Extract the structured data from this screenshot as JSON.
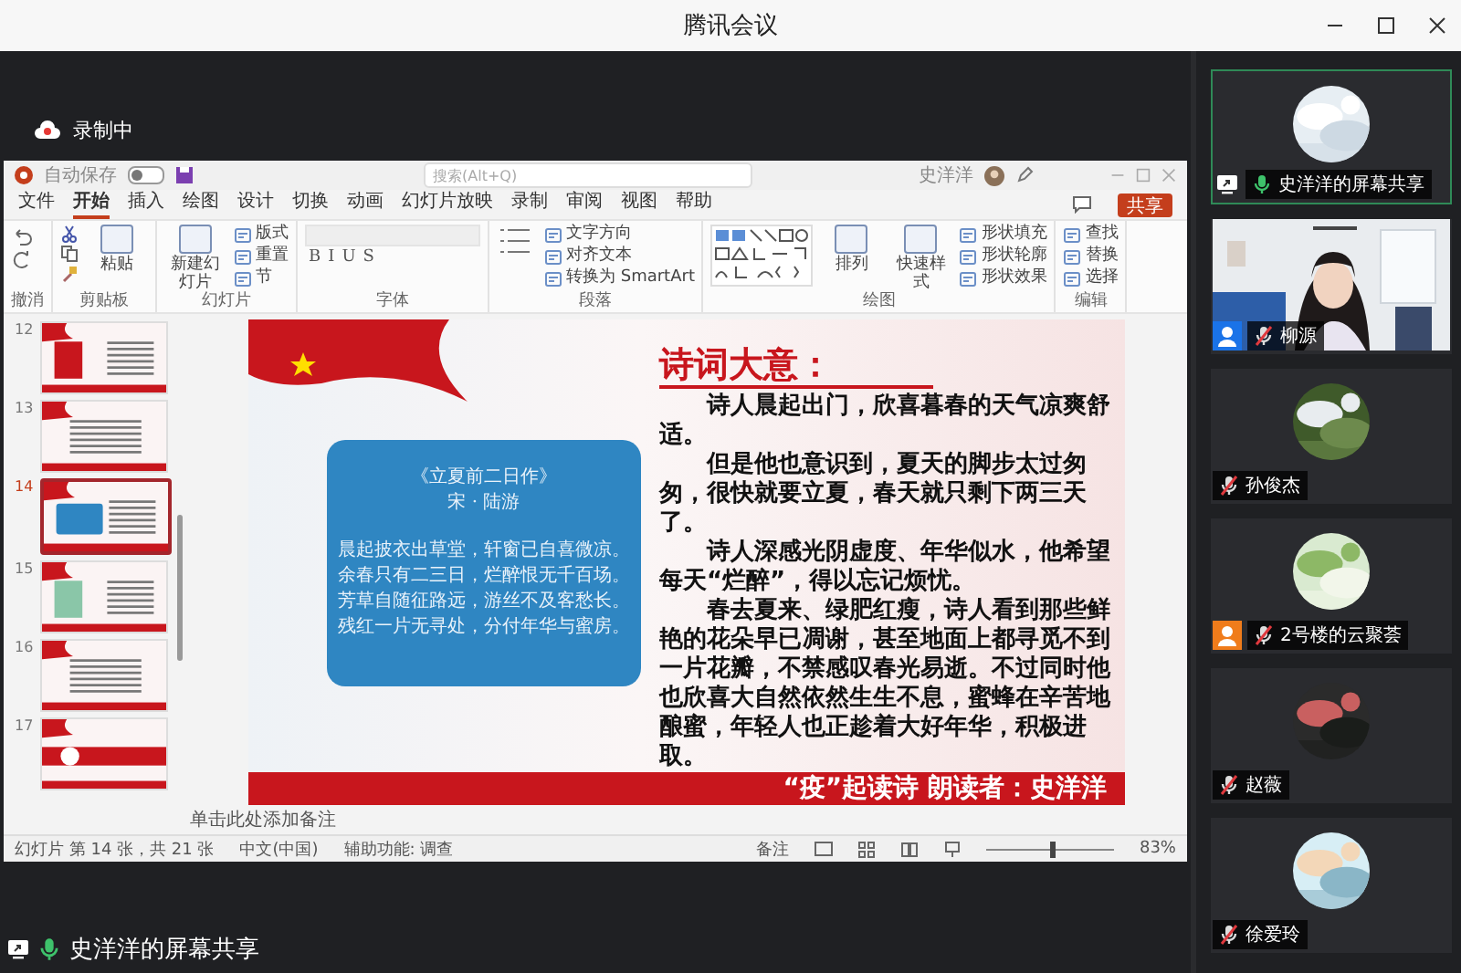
{
  "app": {
    "title": "腾讯会议"
  },
  "recording": {
    "label": "录制中"
  },
  "ppt": {
    "autosave_label": "自动保存",
    "autosave_on": false,
    "search": {
      "placeholder": "搜索(Alt+Q)"
    },
    "user": "史洋洋",
    "share_button": "共享",
    "tabs": [
      {
        "label": "文件",
        "selected": false
      },
      {
        "label": "开始",
        "selected": true
      },
      {
        "label": "插入",
        "selected": false
      },
      {
        "label": "绘图",
        "selected": false
      },
      {
        "label": "设计",
        "selected": false
      },
      {
        "label": "切换",
        "selected": false
      },
      {
        "label": "动画",
        "selected": false
      },
      {
        "label": "幻灯片放映",
        "selected": false
      },
      {
        "label": "录制",
        "selected": false
      },
      {
        "label": "审阅",
        "selected": false
      },
      {
        "label": "视图",
        "selected": false
      },
      {
        "label": "帮助",
        "selected": false
      }
    ],
    "ribbon": [
      {
        "label": "撤消",
        "kind": "undo"
      },
      {
        "label": "剪贴板",
        "kind": "clipboard",
        "items": [
          {
            "kind": "big",
            "label": "粘贴"
          }
        ]
      },
      {
        "label": "幻灯片",
        "kind": "slides",
        "items": [
          {
            "kind": "big",
            "label": "新建幻灯片"
          },
          {
            "kind": "small",
            "label": "版式"
          },
          {
            "kind": "small",
            "label": "重置"
          },
          {
            "kind": "small",
            "label": "节"
          }
        ]
      },
      {
        "label": "字体",
        "kind": "font",
        "items": [
          {
            "kind": "format",
            "label": "B"
          },
          {
            "kind": "format",
            "label": "I"
          },
          {
            "kind": "format",
            "label": "U"
          },
          {
            "kind": "format",
            "label": "S"
          }
        ]
      },
      {
        "label": "段落",
        "kind": "paragraph",
        "items": [
          {
            "kind": "small",
            "label": "文字方向"
          },
          {
            "kind": "small",
            "label": "对齐文本"
          },
          {
            "kind": "small",
            "label": "转换为 SmartArt"
          }
        ]
      },
      {
        "label": "绘图",
        "kind": "drawing",
        "items": [
          {
            "kind": "big",
            "label": "排列"
          },
          {
            "kind": "big",
            "label": "快速样式"
          },
          {
            "kind": "small",
            "label": "形状填充"
          },
          {
            "kind": "small",
            "label": "形状轮廓"
          },
          {
            "kind": "small",
            "label": "形状效果"
          }
        ]
      },
      {
        "label": "编辑",
        "kind": "editing",
        "items": [
          {
            "kind": "small",
            "label": "查找"
          },
          {
            "kind": "small",
            "label": "替换"
          },
          {
            "kind": "small",
            "label": "选择"
          }
        ]
      }
    ],
    "slides": [
      {
        "number": "12",
        "selected": false
      },
      {
        "number": "13",
        "selected": false
      },
      {
        "number": "14",
        "selected": true
      },
      {
        "number": "15",
        "selected": false
      },
      {
        "number": "16",
        "selected": false
      },
      {
        "number": "17",
        "selected": false
      }
    ],
    "slide": {
      "poem": {
        "title": "《立夏前二日作》",
        "author": "宋 · 陆游",
        "lines": [
          "晨起披衣出草堂，轩窗已自喜微凉。",
          "余春只有二三日，烂醉恨无千百场。",
          "芳草自随征路远，游丝不及客愁长。",
          "残红一片无寻处，分付年华与蜜房。"
        ]
      },
      "heading": "诗词大意：",
      "paragraphs": [
        "诗人晨起出门，欣喜暮春的天气凉爽舒适。",
        "但是他也意识到，夏天的脚步太过匆匆，很快就要立夏，春天就只剩下两三天了。",
        "诗人深感光阴虚度、年华似水，他希望每天“烂醉”，得以忘记烦忧。",
        "春去夏来、绿肥红瘦，诗人看到那些鲜艳的花朵早已凋谢，甚至地面上都寻觅不到一片花瓣，不禁感叹春光易逝。不过同时他也欣喜大自然依然生生不息，蜜蜂在辛苦地酿蜜，年轻人也正趁着大好年华，积极进取。"
      ],
      "footer": "“疫”起读诗 朗读者：史洋洋"
    },
    "notes_placeholder": "单击此处添加备注",
    "status": {
      "slide_info": "幻灯片 第 14 张，共 21 张",
      "language": "中文(中国)",
      "accessibility": "辅助功能: 调查",
      "notes_button": "备注",
      "zoom": {
        "level": 0.5,
        "reading": "83%"
      }
    }
  },
  "participants": [
    {
      "name": "史洋洋的屏幕共享",
      "mic_on": true,
      "badge": {
        "kind": "share"
      },
      "highlighted": true,
      "kind": "avatar"
    },
    {
      "name": "柳源",
      "mic_on": false,
      "badge": {
        "kind": "person",
        "color": "#1a73e8"
      },
      "highlighted": false,
      "kind": "video"
    },
    {
      "name": "孙俊杰",
      "mic_on": false,
      "highlighted": false,
      "kind": "avatar"
    },
    {
      "name": "2号楼的云聚荟",
      "mic_on": false,
      "badge": {
        "kind": "person",
        "color": "#f07c1b"
      },
      "highlighted": false,
      "kind": "avatar"
    },
    {
      "name": "赵薇",
      "mic_on": false,
      "highlighted": false,
      "kind": "avatar"
    },
    {
      "name": "徐爱玲",
      "mic_on": false,
      "highlighted": false,
      "kind": "avatar"
    }
  ],
  "share_label": {
    "label": "史洋洋的屏幕共享",
    "mic_on": true
  }
}
